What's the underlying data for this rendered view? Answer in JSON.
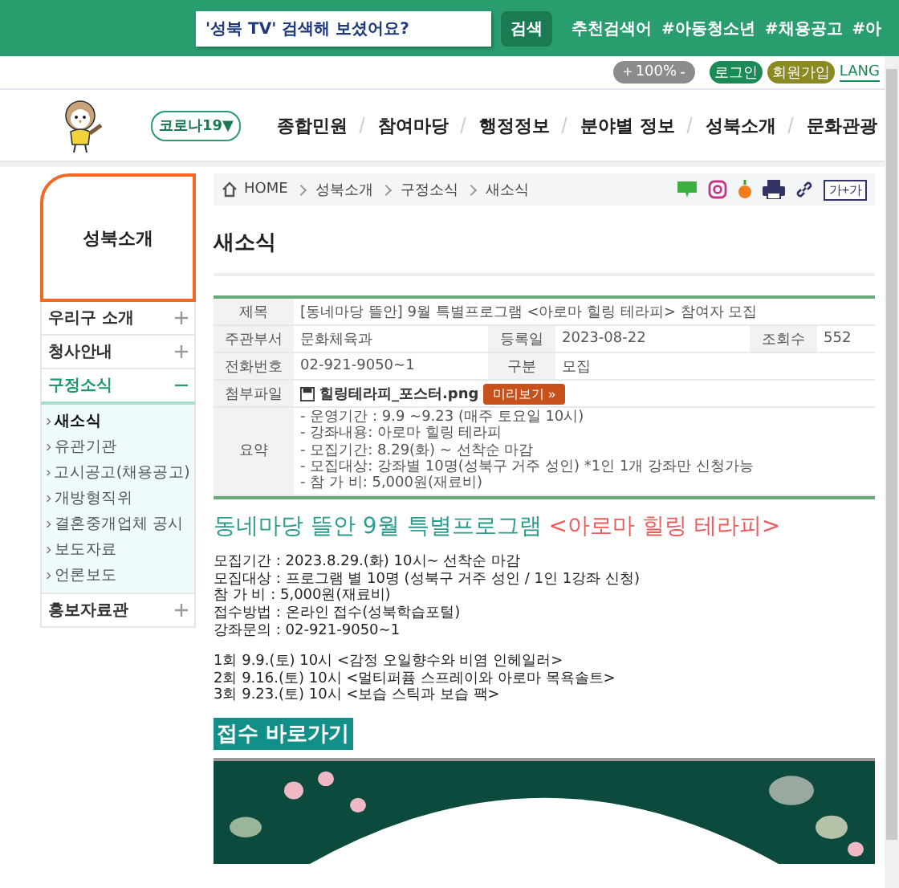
{
  "top_bar": {
    "search": {
      "value": "'성북 TV' 검색해 보셨어요?"
    },
    "search_button": "검색",
    "recommend_label": "추천검색어",
    "tags": [
      "#아동청소년",
      "#채용공고",
      "#아"
    ]
  },
  "utility": {
    "zoom": {
      "plus": "+",
      "value": "100%",
      "minus": "-"
    },
    "login": "로그인",
    "signup": "회원가입",
    "lang": "LANG"
  },
  "nav": {
    "corona": "코로나19▼",
    "items": [
      "종합민원",
      "참여마당",
      "행정정보",
      "분야별 정보",
      "성북소개",
      "문화관광"
    ]
  },
  "sidebar": {
    "title": "성북소개",
    "items": [
      {
        "label": "우리구 소개",
        "expanded": false
      },
      {
        "label": "청사안내",
        "expanded": false
      },
      {
        "label": "구정소식",
        "expanded": true,
        "children": [
          {
            "label": "새소식",
            "selected": true
          },
          {
            "label": "유관기관",
            "selected": false
          },
          {
            "label": "고시공고(채용공고)",
            "selected": false
          },
          {
            "label": "개방형직위",
            "selected": false
          },
          {
            "label": "결혼중개업체 공시",
            "selected": false
          },
          {
            "label": "보도자료",
            "selected": false
          },
          {
            "label": "언론보도",
            "selected": false
          }
        ]
      },
      {
        "label": "홍보자료관",
        "expanded": false
      }
    ]
  },
  "breadcrumb": [
    "HOME",
    "성북소개",
    "구정소식",
    "새소식"
  ],
  "font_size_button": "가+가",
  "page_title": "새소식",
  "info": {
    "subject_label": "제목",
    "subject": "[동네마당 뜰안] 9월 특별프로그램 <아로마 힐링 테라피> 참여자 모집",
    "dept_label": "주관부서",
    "dept": "문화체육과",
    "date_label": "등록일",
    "date": "2023-08-22",
    "views_label": "조회수",
    "views": "552",
    "phone_label": "전화번호",
    "phone": "02-921-9050~1",
    "category_label": "구분",
    "category": "모집",
    "file_label": "첨부파일",
    "file": "힐링테라피_포스터.png",
    "preview_button": "미리보기 »",
    "summary_label": "요약",
    "summary": [
      "- 운영기간 : 9.9 ~9.23 (매주 토요일 10시)",
      "- 강좌내용: 아로마 힐링 테라피",
      "- 모집기간: 8.29(화) ~ 선착순 마감",
      "- 모집대상: 강좌별 10명(성북구 거주 성인) *1인 1개 강좌만 신청가능",
      "- 참  가  비: 5,000원(재료비)"
    ]
  },
  "article": {
    "heading": "동네마당 뜰안 9월 특별프로그램",
    "heading_highlight": "<아로마 힐링 테라피>",
    "lines": [
      "모집기간 : 2023.8.29.(화) 10시~ 선착순 마감",
      "모집대상 : 프로그램 별 10명 (성북구 거주 성인 / 1인 1강좌 신청)",
      "참 가 비 : 5,000원(재료비)",
      "접수방법 : 온라인 접수(성북학습포털)",
      "강좌문의 : 02-921-9050~1"
    ],
    "sessions": [
      "1회 9.9.(토) 10시 <감정 오일향수와 비염 인헤일러>",
      "2회 9.16.(토) 10시 <멀티퍼퓸 스프레이와 아로마 목욕솔트>",
      "3회 9.23.(토) 10시 <보습 스틱과 보습 팩>"
    ],
    "apply_button": "접수 바로가기"
  }
}
